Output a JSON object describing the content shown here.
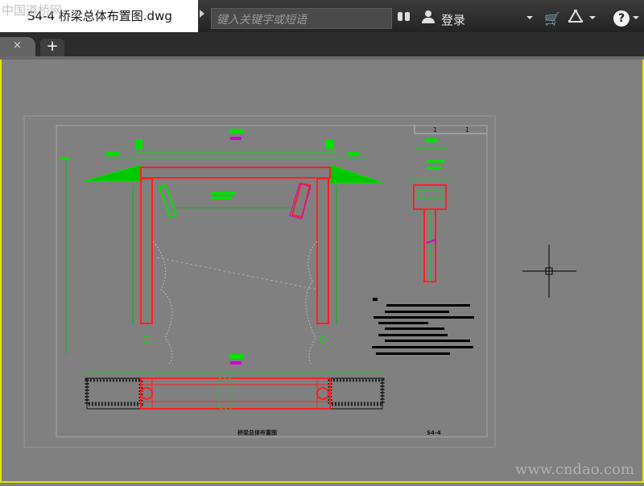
{
  "document": {
    "title": "S4-4 桥梁总体布置图.dwg"
  },
  "watermark": {
    "top": "中国道桥网",
    "bottom": "www.cndao.com"
  },
  "search": {
    "placeholder": "键入关键字或短语"
  },
  "header": {
    "login_label": "登录",
    "help_label": "?"
  },
  "tabs": {
    "close_label": "×",
    "new_label": "+"
  },
  "drawing": {
    "title_block": "桥梁总体布置图",
    "sheet_number": "S4-4",
    "section_labels": [
      "1",
      "1"
    ]
  },
  "colors": {
    "frame": "#e6e600",
    "canvas": "#808080",
    "title_bg": "#ffffff",
    "line_red": "#ff2020",
    "line_green": "#00e000"
  }
}
